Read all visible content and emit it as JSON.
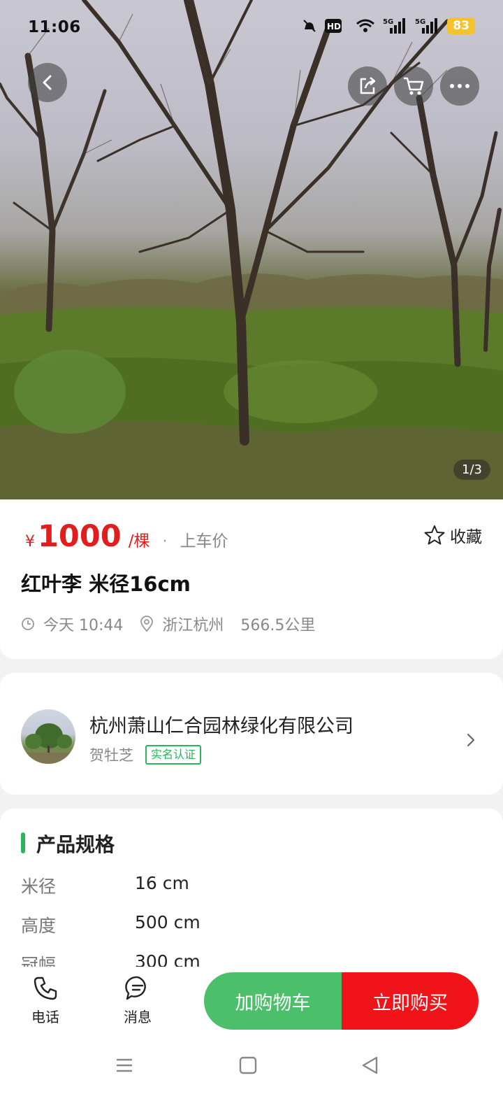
{
  "status_bar": {
    "time": "11:06",
    "battery": "83",
    "network": "5G"
  },
  "hero": {
    "photo_counter": "1/3"
  },
  "toolbar": {
    "back_icon": "chevron-left-icon",
    "share_icon": "share-icon",
    "cart_icon": "cart-icon",
    "more_icon": "more-icon"
  },
  "price": {
    "currency": "¥",
    "value": "1000",
    "unit": "/棵",
    "separator": "·",
    "note": "上车价"
  },
  "favorite": {
    "label": "收藏"
  },
  "product": {
    "title": "红叶李 米径16cm",
    "time": "今天 10:44",
    "location": "浙江杭州",
    "distance": "566.5公里"
  },
  "seller": {
    "company": "杭州萧山仁合园林绿化有限公司",
    "name": "贺牡芝",
    "badge": "实名认证"
  },
  "specs": {
    "title": "产品规格",
    "rows": [
      {
        "key": "米径",
        "value": "16 cm"
      },
      {
        "key": "高度",
        "value": "500 cm"
      },
      {
        "key": "冠幅",
        "value": "300 cm"
      }
    ]
  },
  "actions": {
    "phone_label": "电话",
    "message_label": "消息",
    "add_cart_label": "加购物车",
    "buy_now_label": "立即购买"
  },
  "colors": {
    "accent_green": "#4cbf6b",
    "buy_red": "#f0141a",
    "price_red": "#e01e1e"
  }
}
